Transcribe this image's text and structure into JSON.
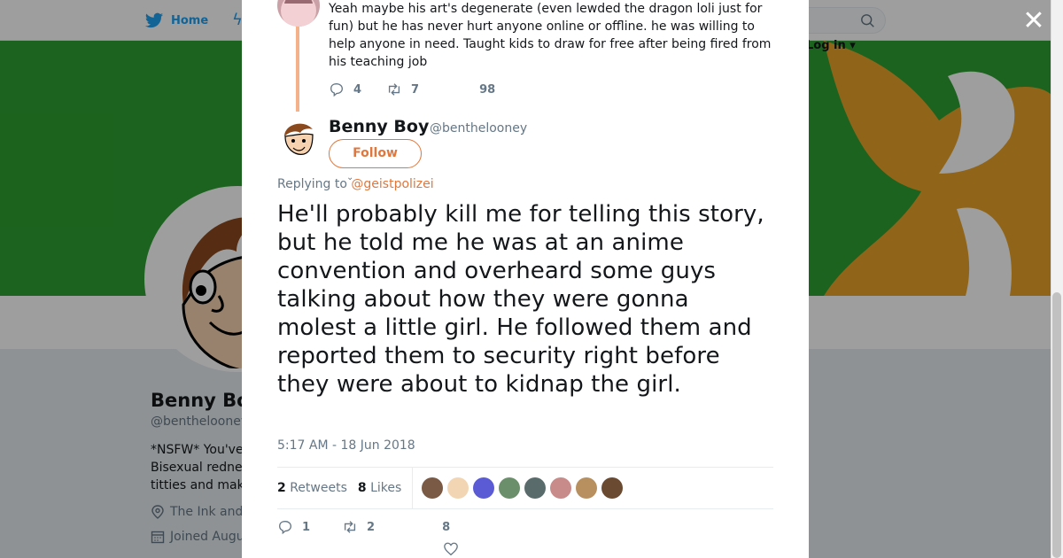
{
  "nav": {
    "home_label": "Home",
    "login_label": "Log in"
  },
  "background_profile": {
    "name": "Benny Bo",
    "handle": "@benthelooney",
    "bio_lines": [
      "*NSFW* You've",
      "Bisexual redne",
      "titties and mak"
    ],
    "location": "The Ink and",
    "joined": "Joined Augu"
  },
  "previous_tweet": {
    "text": "Yeah maybe his art's degenerate (even lewded the dragon loli just for fun) but he has never hurt anyone online or offline. he was willing to help anyone in need. Taught kids to draw for free after being fired from his teaching job",
    "replies": "4",
    "retweets": "7",
    "likes": "98"
  },
  "tweet": {
    "author_name": "Benny Boy",
    "author_handle": "@benthelooney",
    "follow_label": "Follow",
    "replying_prefix": "Replying to",
    "replying_handle": "@geistpolizei",
    "text": "He'll probably kill me for telling this story, but he told me he was at an anime convention and overheard some guys talking about how they were gonna molest a little girl. He followed them and reported them to security right before they were about to kidnap the girl.",
    "timestamp": "5:17 AM - 18 Jun 2018",
    "retweet_count": "2",
    "retweet_label": "Retweets",
    "like_count": "8",
    "like_label": "Likes",
    "replies": "1",
    "retweets": "2",
    "likes": "8"
  },
  "colors": {
    "accent_orange": "#e0773c",
    "twitter_blue": "#1da1f2",
    "banner_green": "#2da131",
    "banner_yellow": "#e8a32a",
    "muted_text": "#657786"
  },
  "likers": [
    {
      "color": "#7a5a45"
    },
    {
      "color": "#f2d6b3"
    },
    {
      "color": "#5b5bd6"
    },
    {
      "color": "#6b8f6b"
    },
    {
      "color": "#5a6b6b"
    },
    {
      "color": "#c98a8a"
    },
    {
      "color": "#b89060"
    },
    {
      "color": "#6a4a30"
    }
  ]
}
